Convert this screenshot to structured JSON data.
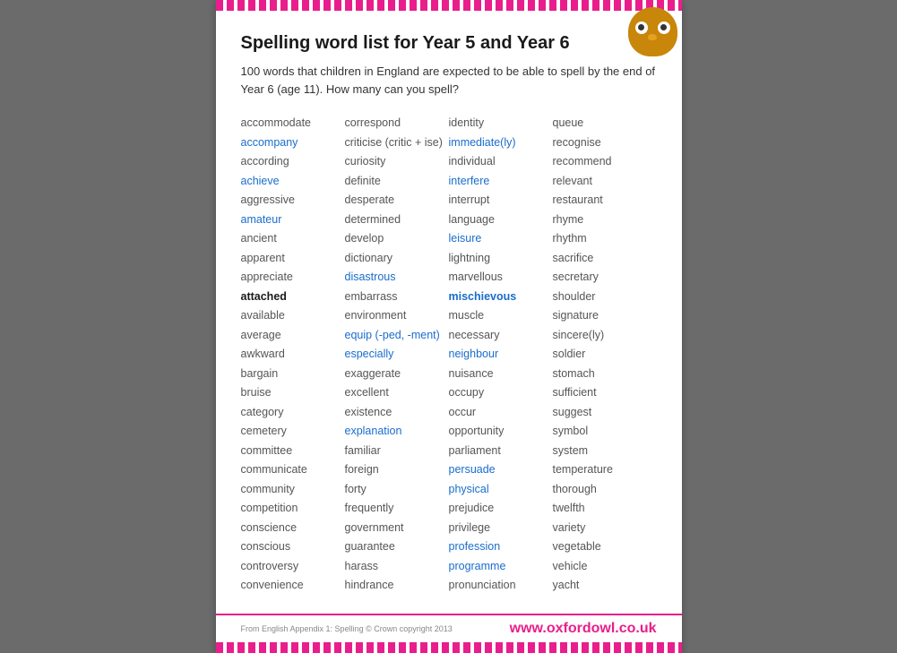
{
  "page": {
    "title": "Spelling word list for Year 5 and Year 6",
    "subtitle": "100 words that children in England are expected to be able to spell by the end of Year 6 (age 11). How many can you spell?",
    "footer_left": "From English Appendix 1: Spelling  © Crown copyright 2013",
    "footer_right": "www.oxfordowl.co.uk"
  },
  "columns": [
    {
      "words": [
        {
          "text": "accommodate",
          "style": "normal"
        },
        {
          "text": "accompany",
          "style": "highlight"
        },
        {
          "text": "according",
          "style": "normal"
        },
        {
          "text": "achieve",
          "style": "highlight"
        },
        {
          "text": "aggressive",
          "style": "normal"
        },
        {
          "text": "amateur",
          "style": "highlight"
        },
        {
          "text": "ancient",
          "style": "normal"
        },
        {
          "text": "apparent",
          "style": "normal"
        },
        {
          "text": "appreciate",
          "style": "normal"
        },
        {
          "text": "attached",
          "style": "dark-bold"
        },
        {
          "text": "available",
          "style": "normal"
        },
        {
          "text": "average",
          "style": "normal"
        },
        {
          "text": "awkward",
          "style": "normal"
        },
        {
          "text": "bargain",
          "style": "normal"
        },
        {
          "text": "bruise",
          "style": "normal"
        },
        {
          "text": "category",
          "style": "normal"
        },
        {
          "text": "cemetery",
          "style": "normal"
        },
        {
          "text": "committee",
          "style": "normal"
        },
        {
          "text": "communicate",
          "style": "normal"
        },
        {
          "text": "community",
          "style": "normal"
        },
        {
          "text": "competition",
          "style": "normal"
        },
        {
          "text": "conscience",
          "style": "normal"
        },
        {
          "text": "conscious",
          "style": "normal"
        },
        {
          "text": "controversy",
          "style": "normal"
        },
        {
          "text": "convenience",
          "style": "normal"
        }
      ]
    },
    {
      "words": [
        {
          "text": "correspond",
          "style": "normal"
        },
        {
          "text": "criticise (critic + ise)",
          "style": "normal"
        },
        {
          "text": "curiosity",
          "style": "normal"
        },
        {
          "text": "definite",
          "style": "normal"
        },
        {
          "text": "desperate",
          "style": "normal"
        },
        {
          "text": "determined",
          "style": "normal"
        },
        {
          "text": "develop",
          "style": "normal"
        },
        {
          "text": "dictionary",
          "style": "normal"
        },
        {
          "text": "disastrous",
          "style": "highlight"
        },
        {
          "text": "embarrass",
          "style": "normal"
        },
        {
          "text": "environment",
          "style": "normal"
        },
        {
          "text": "equip (-ped, -ment)",
          "style": "highlight"
        },
        {
          "text": "especially",
          "style": "highlight"
        },
        {
          "text": "exaggerate",
          "style": "normal"
        },
        {
          "text": "excellent",
          "style": "normal"
        },
        {
          "text": "existence",
          "style": "normal"
        },
        {
          "text": "explanation",
          "style": "highlight"
        },
        {
          "text": "familiar",
          "style": "normal"
        },
        {
          "text": "foreign",
          "style": "normal"
        },
        {
          "text": "forty",
          "style": "normal"
        },
        {
          "text": "frequently",
          "style": "normal"
        },
        {
          "text": "government",
          "style": "normal"
        },
        {
          "text": "guarantee",
          "style": "normal"
        },
        {
          "text": "harass",
          "style": "normal"
        },
        {
          "text": "hindrance",
          "style": "normal"
        }
      ]
    },
    {
      "words": [
        {
          "text": "identity",
          "style": "normal"
        },
        {
          "text": "immediate(ly)",
          "style": "highlight"
        },
        {
          "text": "individual",
          "style": "normal"
        },
        {
          "text": "interfere",
          "style": "highlight"
        },
        {
          "text": "interrupt",
          "style": "normal"
        },
        {
          "text": "language",
          "style": "normal"
        },
        {
          "text": "leisure",
          "style": "highlight"
        },
        {
          "text": "lightning",
          "style": "normal"
        },
        {
          "text": "marvellous",
          "style": "normal"
        },
        {
          "text": "mischievous",
          "style": "bold-highlight"
        },
        {
          "text": "muscle",
          "style": "normal"
        },
        {
          "text": "necessary",
          "style": "normal"
        },
        {
          "text": "neighbour",
          "style": "highlight"
        },
        {
          "text": "nuisance",
          "style": "normal"
        },
        {
          "text": "occupy",
          "style": "normal"
        },
        {
          "text": "occur",
          "style": "normal"
        },
        {
          "text": "opportunity",
          "style": "normal"
        },
        {
          "text": "parliament",
          "style": "normal"
        },
        {
          "text": "persuade",
          "style": "highlight"
        },
        {
          "text": "physical",
          "style": "highlight"
        },
        {
          "text": "prejudice",
          "style": "normal"
        },
        {
          "text": "privilege",
          "style": "normal"
        },
        {
          "text": "profession",
          "style": "highlight"
        },
        {
          "text": "programme",
          "style": "highlight"
        },
        {
          "text": "pronunciation",
          "style": "normal"
        }
      ]
    },
    {
      "words": [
        {
          "text": "queue",
          "style": "normal"
        },
        {
          "text": "recognise",
          "style": "normal"
        },
        {
          "text": "recommend",
          "style": "normal"
        },
        {
          "text": "relevant",
          "style": "normal"
        },
        {
          "text": "restaurant",
          "style": "normal"
        },
        {
          "text": "rhyme",
          "style": "normal"
        },
        {
          "text": "rhythm",
          "style": "normal"
        },
        {
          "text": "sacrifice",
          "style": "normal"
        },
        {
          "text": "secretary",
          "style": "normal"
        },
        {
          "text": "shoulder",
          "style": "normal"
        },
        {
          "text": "signature",
          "style": "normal"
        },
        {
          "text": "sincere(ly)",
          "style": "normal"
        },
        {
          "text": "soldier",
          "style": "normal"
        },
        {
          "text": "stomach",
          "style": "normal"
        },
        {
          "text": "sufficient",
          "style": "normal"
        },
        {
          "text": "suggest",
          "style": "normal"
        },
        {
          "text": "symbol",
          "style": "normal"
        },
        {
          "text": "system",
          "style": "normal"
        },
        {
          "text": "temperature",
          "style": "normal"
        },
        {
          "text": "thorough",
          "style": "normal"
        },
        {
          "text": "twelfth",
          "style": "normal"
        },
        {
          "text": "variety",
          "style": "normal"
        },
        {
          "text": "vegetable",
          "style": "normal"
        },
        {
          "text": "vehicle",
          "style": "normal"
        },
        {
          "text": "yacht",
          "style": "normal"
        }
      ]
    }
  ]
}
